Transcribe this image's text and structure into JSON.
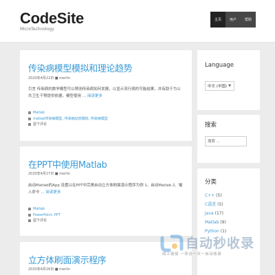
{
  "site": {
    "title": "CodeSite",
    "description": "MicroTechnology",
    "nav": [
      {
        "label": "主页"
      },
      {
        "label": "用户"
      },
      {
        "label": "帮助"
      }
    ]
  },
  "posts": [
    {
      "title": "传染病模型模拟和理论趋势",
      "meta": "2020年4月22日 ■ merlin",
      "excerpt": "引言 传染病的数学模型可以预测传染病如何发展，以显示流行病的可能结果，并有助于为公共卫生干预提供依据。模型使用 …",
      "read_more": "阅读更多",
      "category": "Matlab",
      "tags": "matlab传染病模型, 传染病动态模拟, 传染病模型",
      "comment": "留下评论"
    },
    {
      "title": "在PPT中使用Matlab",
      "meta": "2020年4月27日 ■ merlin",
      "excerpt": "启动Matlab的App 设置以在PPT中完美启动立方体刷面演示程序为例 1、启动Matlab 2、输入命令 …",
      "read_more": "阅读更多",
      "category": "Matlab",
      "tags": "PowerPoint, PPT",
      "comment": "留下评论"
    },
    {
      "title": "立方体刷面演示程序",
      "meta": "2020年4月26日 ■ merlin"
    }
  ],
  "sidebar": {
    "language": {
      "title": "Language",
      "selected": "中文 (中国)"
    },
    "search": {
      "title": "搜索",
      "placeholder": "搜索 ..."
    },
    "categories": {
      "title": "分类",
      "items": [
        {
          "name": "C++",
          "count": "(5)"
        },
        {
          "name": "C语言",
          "count": "(5)"
        },
        {
          "name": "Java",
          "count": "(17)"
        },
        {
          "name": "Matlab",
          "count": "(9)"
        },
        {
          "name": "Python",
          "count": "(1)"
        }
      ]
    }
  },
  "watermark": {
    "main": "自动秒收录",
    "sub": "收上链接 一来访一次一自动收录"
  },
  "colors": {
    "link": "#3a9bd5",
    "nav_bg": "#464646",
    "nav_active": "#222222",
    "page_bg": "#ececec"
  }
}
